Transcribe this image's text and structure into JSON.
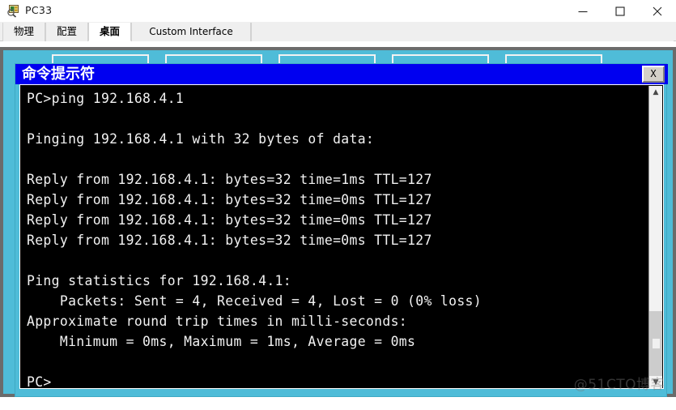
{
  "window": {
    "title": "PC33",
    "icon": "pc-magnifier-icon",
    "controls": {
      "minimize": "—",
      "maximize": "□",
      "close": "✕",
      "minimize_name": "minimize",
      "maximize_name": "maximize",
      "close_name": "close"
    }
  },
  "tabs": [
    {
      "label": "物理",
      "active": false,
      "cjk": true
    },
    {
      "label": "配置",
      "active": false,
      "cjk": true
    },
    {
      "label": "桌面",
      "active": true,
      "cjk": true
    },
    {
      "label": "Custom Interface",
      "active": false,
      "cjk": false
    }
  ],
  "desktop": {
    "background_color": "#4fbcd8",
    "tiles": [
      {
        "name": "desktop-tile-1"
      },
      {
        "name": "desktop-tile-2"
      },
      {
        "name": "desktop-tile-3"
      },
      {
        "name": "desktop-tile-4"
      },
      {
        "name": "desktop-tile-5"
      }
    ]
  },
  "command_prompt": {
    "title": "命令提示符",
    "titlebar_color": "#0000f0",
    "close_label": "X",
    "terminal_bg": "#000000",
    "terminal_fg": "#f2f2f2",
    "lines": [
      "PC>ping 192.168.4.1",
      "",
      "Pinging 192.168.4.1 with 32 bytes of data:",
      "",
      "Reply from 192.168.4.1: bytes=32 time=1ms TTL=127",
      "Reply from 192.168.4.1: bytes=32 time=0ms TTL=127",
      "Reply from 192.168.4.1: bytes=32 time=0ms TTL=127",
      "Reply from 192.168.4.1: bytes=32 time=0ms TTL=127",
      "",
      "Ping statistics for 192.168.4.1:",
      "    Packets: Sent = 4, Received = 4, Lost = 0 (0% loss)",
      "Approximate round trip times in milli-seconds:",
      "    Minimum = 0ms, Maximum = 1ms, Average = 0ms",
      "",
      "PC>"
    ],
    "scrollbar": {
      "up_arrow": "▲",
      "down_arrow": "▼"
    }
  },
  "watermark": {
    "text": "@51CTO博客"
  }
}
